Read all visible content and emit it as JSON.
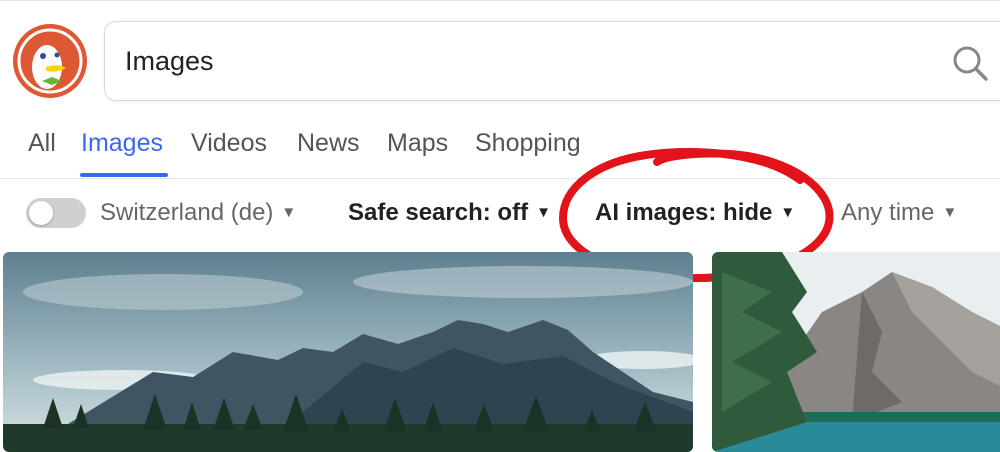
{
  "search": {
    "query": "Images"
  },
  "tabs": [
    {
      "label": "All"
    },
    {
      "label": "Images"
    },
    {
      "label": "Videos"
    },
    {
      "label": "News"
    },
    {
      "label": "Maps"
    },
    {
      "label": "Shopping"
    }
  ],
  "filters": {
    "region": "Switzerland (de)",
    "safe_search": "Safe search: off",
    "ai_images": "AI images: hide",
    "time": "Any time"
  },
  "colors": {
    "accent": "#3969ef",
    "annotation": "#e3131b",
    "logo": "#de5833"
  },
  "icons": [
    "duckduckgo-logo",
    "search-icon",
    "caret-down-icon"
  ]
}
